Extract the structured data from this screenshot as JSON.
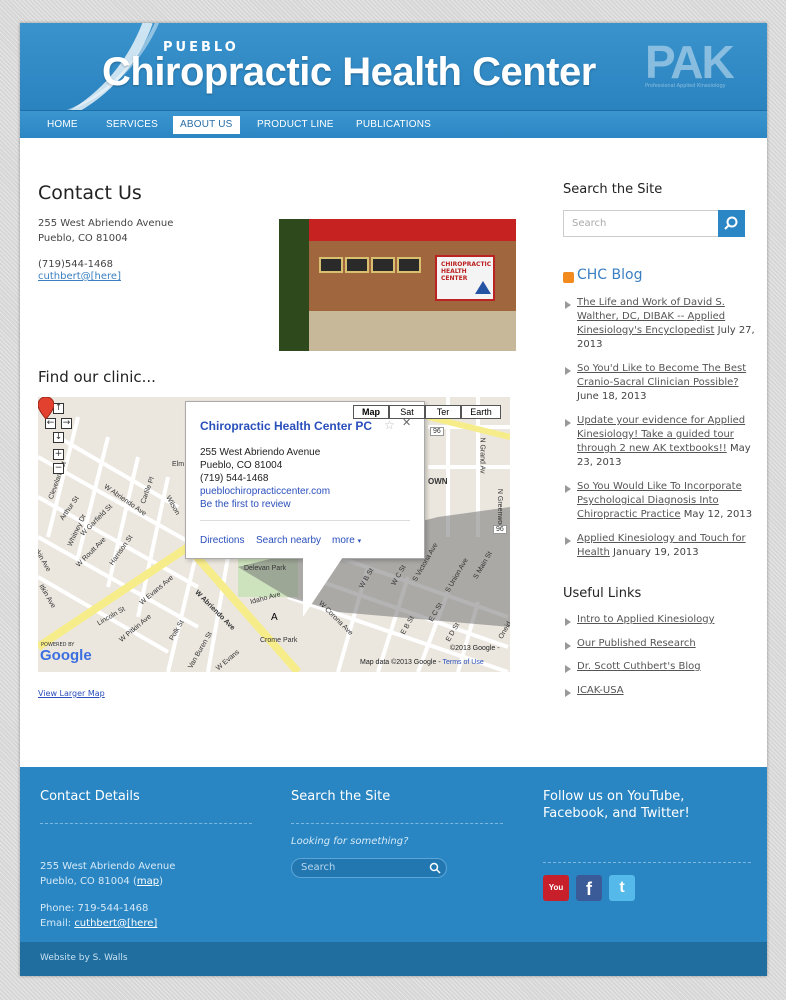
{
  "header": {
    "brand_top": "PUEBLO",
    "brand_main": "Chiropractic Health Center",
    "logo_text": "PAK",
    "logo_sub": "Professional Applied Kinesiology"
  },
  "nav": {
    "items": [
      "HOME",
      "SERVICES",
      "ABOUT US",
      "PRODUCT LINE",
      "PUBLICATIONS"
    ],
    "active": "ABOUT US"
  },
  "contact": {
    "heading": "Contact Us",
    "address_line1": "255 West Abriendo Avenue",
    "address_line2": "Pueblo, CO 81004",
    "phone": "(719)544-1468",
    "email": "cuthbert@[here]",
    "photo_sign": "CHIROPRACTIC HEALTH CENTER"
  },
  "find": {
    "heading": "Find our clinic...",
    "larger_map": "View Larger Map"
  },
  "map": {
    "types": [
      "Map",
      "Sat",
      "Ter",
      "Earth"
    ],
    "selected_type": "Map",
    "popup_title": "Chiropractic Health Center PC",
    "popup_address1": "255 West Abriendo Avenue",
    "popup_address2": "Pueblo, CO 81004",
    "popup_phone": "(719) 544-1468",
    "popup_website": "pueblochiropracticcenter.com",
    "popup_review": "Be the first to review",
    "popup_actions": [
      "Directions",
      "Search nearby",
      "more"
    ],
    "marker_letter": "A",
    "copyright": "©2013 Google -",
    "map_data": "Map data ©2013 Google -",
    "terms": "Terms of Use",
    "powered_by": "POWERED BY",
    "google": "Google",
    "streets": {
      "abriendo_long": "W Abriendo Ave",
      "abriendo_small": "W Abriendo Ave",
      "lincoln": "Lincoln St",
      "elm": "Elm",
      "carlile": "Carlile Pl",
      "wilson": "Wilson",
      "arthur": "Arthur St",
      "whitney": "Whitney Dr",
      "garfield": "W Garfield St",
      "routt": "W Routt Ave",
      "harrison": "Harrison St",
      "pitkin": "W Pitkin Ave",
      "evans": "W Evans Ave",
      "polk": "Polk St",
      "van_buren": "Van Buren St",
      "evans2": "W Evans",
      "idaho": "Idaho Ave",
      "delevan": "Delevan Park",
      "corona": "W Corona Ave",
      "b_st": "W B St",
      "c_st": "W C St",
      "union": "S Union Ave",
      "b_st2": "E B St",
      "c_st2": "E C St",
      "d_st": "E D St",
      "main": "S Main St",
      "victoria": "S Victoria Ave",
      "grand": "N Grand Av",
      "greenwood": "N Greenwood",
      "cleveland": "Cleveland St",
      "crome": "Crome Park",
      "own": "OWN",
      "hwy96": "96",
      "hwy96b": "96",
      "ontario": "Ontario",
      "oneida": "Oneid",
      "pitkin_side": "itkin Ave",
      "rkin_side": "rkin Ave"
    }
  },
  "sidebar": {
    "search_heading": "Search the Site",
    "search_placeholder": "Search",
    "blog_heading": "CHC Blog",
    "posts": [
      {
        "title": "The Life and Work of David S. Walther, DC, DIBAK -- Applied Kinesiology's Encyclopedist",
        "date": "July 27, 2013"
      },
      {
        "title": "So You'd Like to Become The Best Cranio-Sacral Clinician Possible?",
        "date": "June 18, 2013"
      },
      {
        "title": "Update your evidence for Applied Kinesiology! Take a guided tour through 2 new AK textbooks!!",
        "date": "May 23, 2013"
      },
      {
        "title": "So You Would Like To Incorporate Psychological Diagnosis Into Chiropractic Practice",
        "date": "May 12, 2013"
      },
      {
        "title": "Applied Kinesiology and Touch for Health",
        "date": "January 19, 2013"
      }
    ],
    "links_heading": "Useful Links",
    "links": [
      "Intro to Applied Kinesiology",
      "Our Published Research",
      "Dr. Scott Cuthbert's Blog",
      "ICAK-USA"
    ]
  },
  "footer": {
    "contact_heading": "Contact Details",
    "address_line1": "255 West Abriendo Avenue",
    "address_line2": "Pueblo, CO 81004",
    "map_link": "map",
    "phone": "Phone: 719-544-1468",
    "email_label": "Email:",
    "email": "cuthbert@[here]",
    "search_heading": "Search the Site",
    "looking": "Looking for something?",
    "search_placeholder": "Search",
    "follow_heading_line1": "Follow us on YouTube,",
    "follow_heading_line2": "Facebook, and Twitter!",
    "social": [
      "YouTube",
      "Facebook",
      "Twitter"
    ],
    "social_glyphs": [
      "You",
      "f",
      "t"
    ],
    "credit": "Website by S. Walls"
  },
  "colors": {
    "brand_blue": "#2a86c3",
    "footer_dark": "#1f6e9f",
    "link_blue": "#3a7fc1"
  }
}
